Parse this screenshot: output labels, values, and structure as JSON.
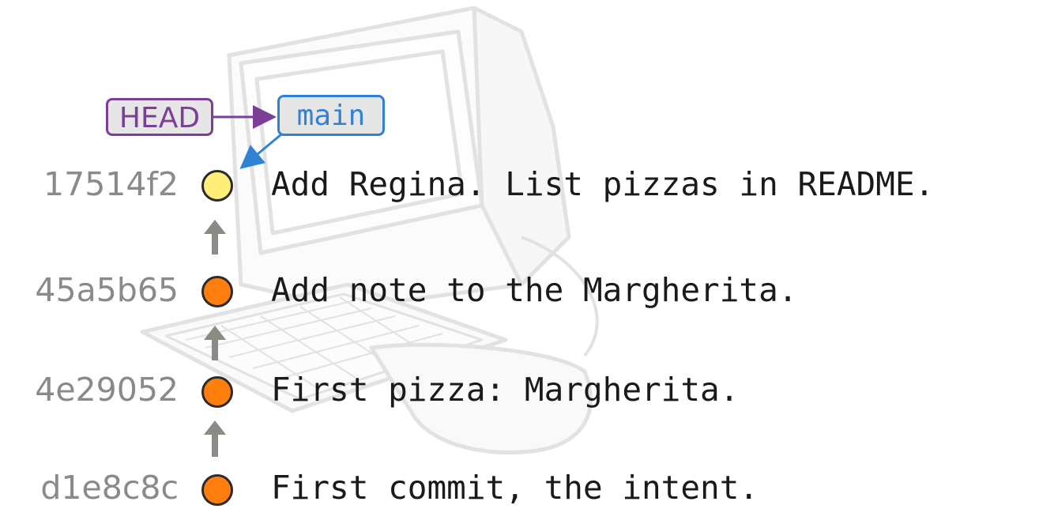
{
  "refs": {
    "head_label": "HEAD",
    "branch_label": "main"
  },
  "commits": [
    {
      "sha": "17514f2",
      "message": "Add Regina. List pizzas in README.",
      "color": "#ffee77"
    },
    {
      "sha": "45a5b65",
      "message": "Add note to the Margherita.",
      "color": "#ff7f0e"
    },
    {
      "sha": "4e29052",
      "message": "First pizza: Margherita.",
      "color": "#ff7f0e"
    },
    {
      "sha": "d1e8c8c",
      "message": "First commit, the intent.",
      "color": "#ff7f0e"
    }
  ],
  "colors": {
    "head": "#7b3f98",
    "branch": "#2f82d4",
    "parent_arrow": "#8c8a85",
    "node_border": "#2b2b2b",
    "sha_text": "#8a8a8a"
  },
  "icons": {
    "background": "computer-icon",
    "parent_link": "arrow-up-icon"
  }
}
